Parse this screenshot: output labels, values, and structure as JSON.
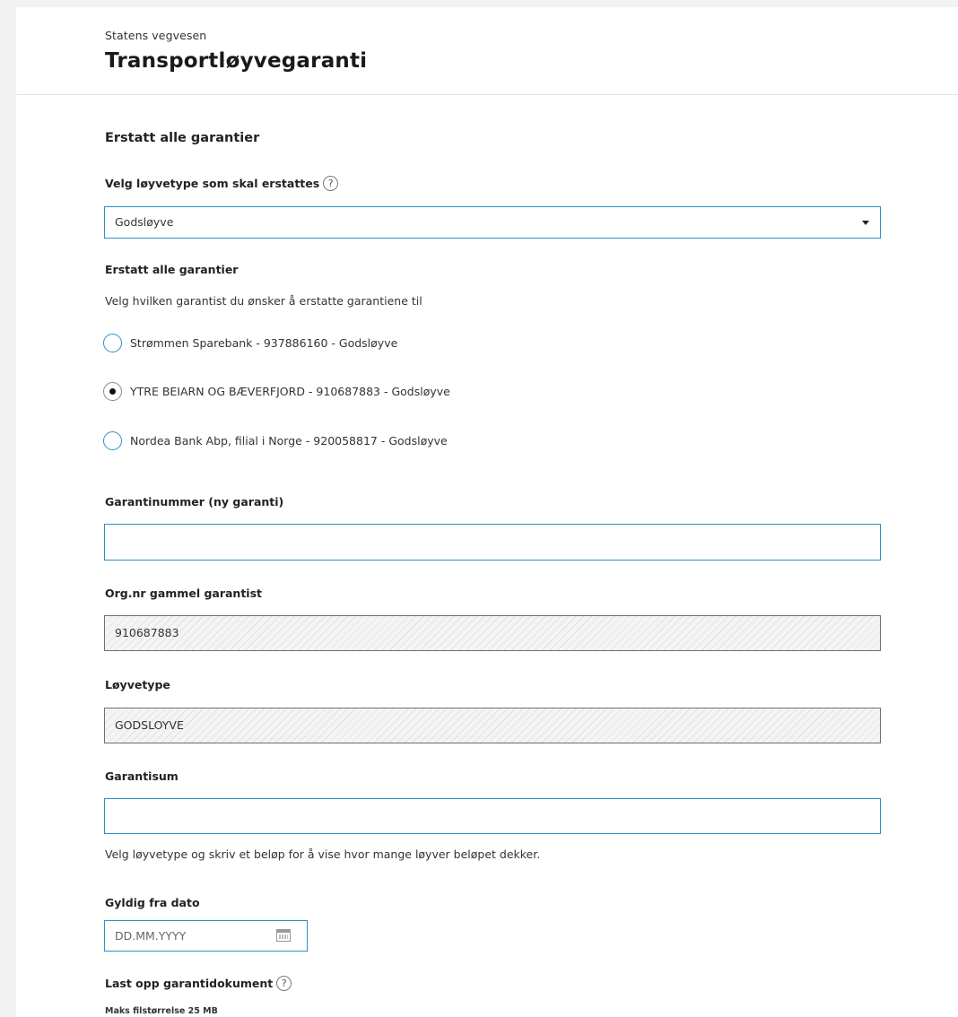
{
  "header": {
    "organization": "Statens vegvesen",
    "title": "Transportløyvegaranti"
  },
  "form": {
    "section_title": "Erstatt alle garantier",
    "license_type_select": {
      "label": "Velg løyvetype som skal erstattes",
      "help_icon": "question-circle-icon",
      "help_text": "?",
      "value": "Godsløyve"
    },
    "replace_all": {
      "label": "Erstatt alle garantier",
      "description": "Velg hvilken garantist du ønsker å erstatte garantiene til",
      "options": [
        {
          "label": "Strømmen Sparebank - 937886160 - Godsløyve",
          "checked": false
        },
        {
          "label": "YTRE BEIARN OG BÆVERFJORD - 910687883 - Godsløyve",
          "checked": true
        },
        {
          "label": "Nordea Bank Abp, filial i Norge - 920058817 - Godsløyve",
          "checked": false
        }
      ]
    },
    "guarantee_number": {
      "label": "Garantinummer (ny garanti)",
      "value": ""
    },
    "old_guarantor_org": {
      "label": "Org.nr gammel garantist",
      "value": "910687883"
    },
    "license_type": {
      "label": "Løyvetype",
      "value": "GODSLOYVE"
    },
    "guarantee_sum": {
      "label": "Garantisum",
      "value": "",
      "hint": "Velg løyvetype og skriv et beløp for å vise hvor mange løyver beløpet dekker."
    },
    "valid_from": {
      "label": "Gyldig fra dato",
      "placeholder": "DD.MM.YYYY",
      "icon": "calendar-icon"
    },
    "upload": {
      "label": "Last opp garantidokument",
      "help_text": "?",
      "max_size": "Maks filstørrelse 25 MB"
    }
  },
  "colors": {
    "focus_border": "#2d8fc4",
    "readonly_border": "#6f6f6f",
    "page_background": "#f2f2f2"
  }
}
